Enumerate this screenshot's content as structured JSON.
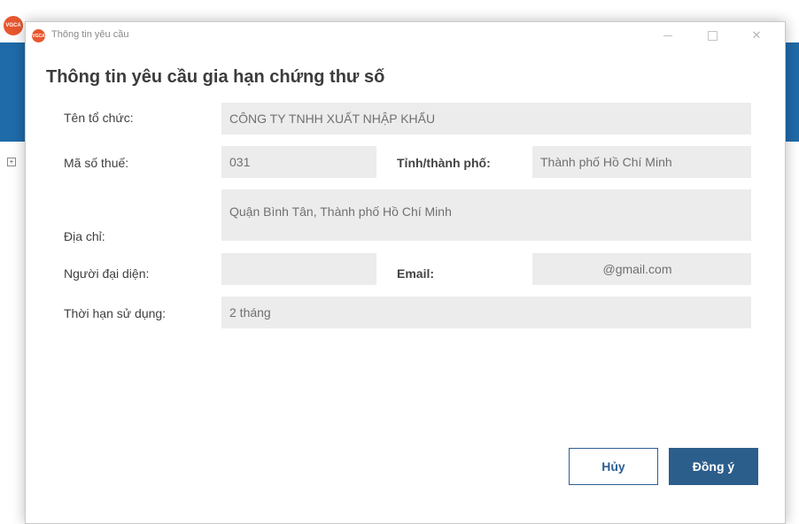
{
  "background_app": {
    "icon_text": "VGCA",
    "band_color": "#1f6aa8"
  },
  "window": {
    "icon_text": "VGCA",
    "title": "Thông tin yêu cầu",
    "controls": {
      "minimize": "—",
      "maximize": "",
      "close": "✕"
    }
  },
  "form": {
    "heading": "Thông tin yêu cầu gia hạn chứng thư số",
    "org_name": {
      "label": "Tên tổ chức:",
      "value": "CÔNG TY TNHH XUẤT NHẬP KHẨU"
    },
    "tax_code": {
      "label": "Mã số thuế:",
      "value": "031"
    },
    "province": {
      "label": "Tỉnh/thành phố:",
      "value": "Thành phố Hồ Chí Minh"
    },
    "address": {
      "label": "Địa chỉ:",
      "value": "Quận Bình Tân, Thành phố Hồ Chí Minh"
    },
    "representative": {
      "label": "Người đại diện:",
      "value": ""
    },
    "email": {
      "label": "Email:",
      "value": "@gmail.com"
    },
    "validity": {
      "label": "Thời hạn sử dụng:",
      "value": "2 tháng"
    }
  },
  "buttons": {
    "cancel": "Hủy",
    "ok": "Đồng ý"
  },
  "colors": {
    "primary": "#2c5e8c",
    "field_bg": "#ececec",
    "icon_orange": "#e8572f"
  }
}
